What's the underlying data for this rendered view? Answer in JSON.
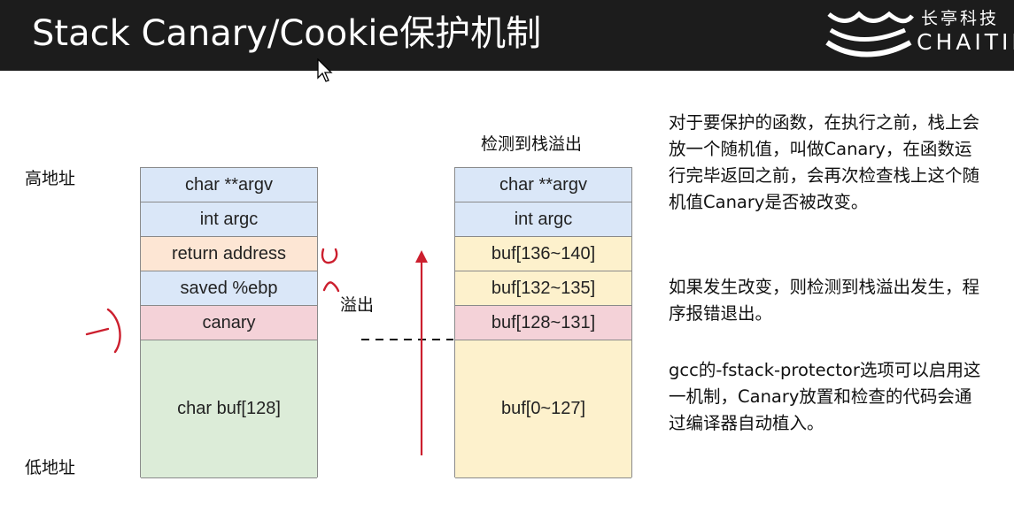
{
  "header": {
    "title": "Stack Canary/Cookie保护机制",
    "logo_cn": "长亭科技",
    "logo_en": "CHAITIN"
  },
  "labels": {
    "high_address": "高地址",
    "low_address": "低地址",
    "overflow": "溢出",
    "detected_title": "检测到栈溢出"
  },
  "left_stack": [
    {
      "label": "char **argv",
      "color": "#dae7f8"
    },
    {
      "label": "int argc",
      "color": "#dae7f8"
    },
    {
      "label": "return address",
      "color": "#fde6d4"
    },
    {
      "label": "saved %ebp",
      "color": "#dae7f8"
    },
    {
      "label": "canary",
      "color": "#f4d2d8"
    },
    {
      "label": "char buf[128]",
      "color": "#dcecd8"
    }
  ],
  "right_stack": [
    {
      "label": "char **argv",
      "color": "#dae7f8"
    },
    {
      "label": "int argc",
      "color": "#dae7f8"
    },
    {
      "label": "buf[136~140]",
      "color": "#fdf1cc"
    },
    {
      "label": "buf[132~135]",
      "color": "#fdf1cc"
    },
    {
      "label": "buf[128~131]",
      "color": "#f4d2d8"
    },
    {
      "label": "buf[0~127]",
      "color": "#fdf1cc"
    }
  ],
  "description": {
    "p1": "对于要保护的函数，在执行之前，栈上会放一个随机值，叫做Canary，在函数运行完毕返回之前，会再次检查栈上这个随机值Canary是否被改变。",
    "p2": "如果发生改变，则检测到栈溢出发生，程序报错退出。",
    "p3": "gcc的-fstack-protector选项可以启用这一机制，Canary放置和检查的代码会通过编译器自动植入。"
  },
  "colors": {
    "header_bg": "#1c1c1c",
    "annotation_red": "#cc1f2e"
  }
}
